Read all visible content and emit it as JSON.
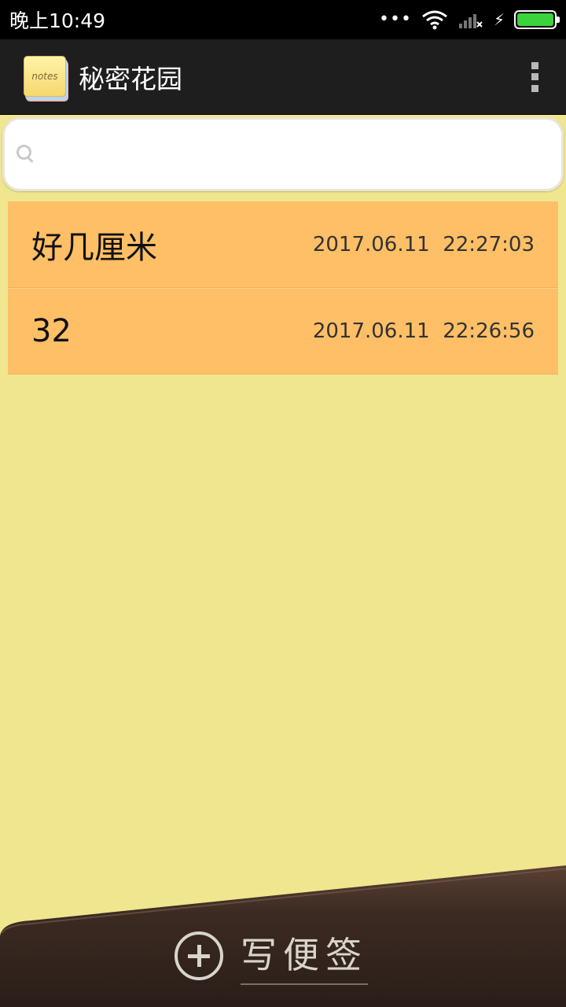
{
  "status_bar": {
    "time": "晚上10:49",
    "dots": "•••",
    "bolt": "⚡"
  },
  "action_bar": {
    "title": "秘密花园",
    "icon_text": "notes"
  },
  "search": {
    "value": "",
    "placeholder": ""
  },
  "notes": [
    {
      "title": "好几厘米",
      "date": "2017.06.11",
      "time": "22:27:03"
    },
    {
      "title": "32",
      "date": "2017.06.11",
      "time": "22:26:56"
    }
  ],
  "compose": {
    "label": "写便签"
  },
  "colors": {
    "background": "#EFE68F",
    "note": "#FEBF66",
    "action_bar": "#1E1E1E",
    "battery": "#3BD33B"
  }
}
